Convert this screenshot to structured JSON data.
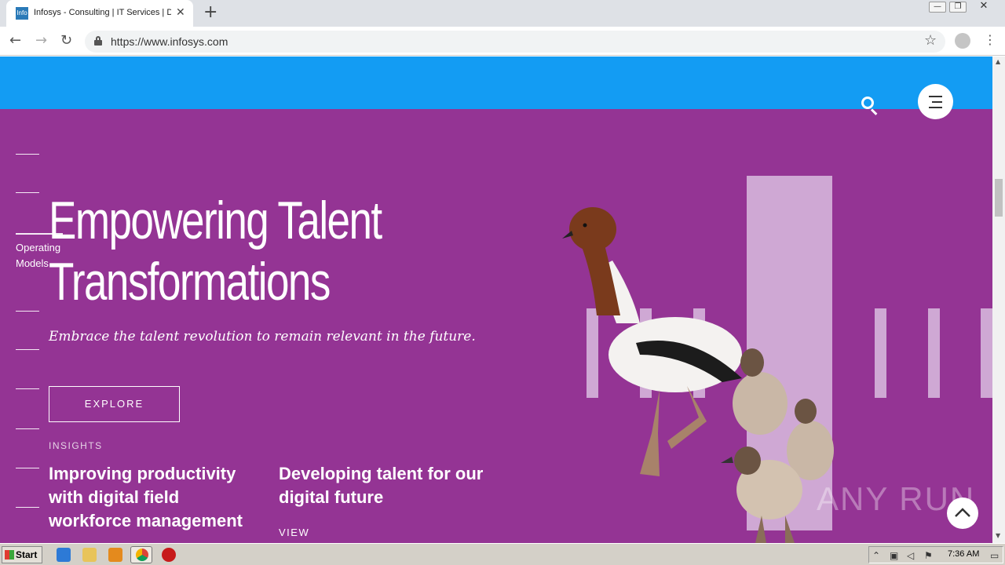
{
  "browser": {
    "tab_favicon_text": "Info",
    "tab_title": "Infosys - Consulting | IT Services | D",
    "url": "https://www.infosys.com",
    "icons": [
      "back-arrow-icon",
      "forward-arrow-icon",
      "reload-icon",
      "lock-icon",
      "star-icon",
      "profile-icon",
      "menu-dots-icon",
      "new-tab-plus-icon",
      "tab-close-icon"
    ]
  },
  "page": {
    "colors": {
      "header_blue": "#139cf3",
      "hero_purple": "#943494",
      "pale_column": "#cfa8d4"
    },
    "side_nav": {
      "active_label_line1": "Operating",
      "active_label_line2": "Models"
    },
    "hero": {
      "headline_line1": "Empowering Talent",
      "headline_line2": "Transformations",
      "subheadline": "Embrace the talent revolution to remain relevant in the future.",
      "cta_label": "EXPLORE"
    },
    "insights": {
      "label": "INSIGHTS",
      "items": [
        {
          "title": "Improving productivity with digital field workforce management"
        },
        {
          "title": "Developing talent for our digital future",
          "link_label": "VIEW"
        }
      ]
    },
    "watermark": "ANY RUN"
  },
  "taskbar": {
    "start_label": "Start",
    "clock": "7:36 AM",
    "icons": [
      "ie-icon",
      "folder-icon",
      "media-player-icon",
      "chrome-icon",
      "stop-icon"
    ]
  }
}
